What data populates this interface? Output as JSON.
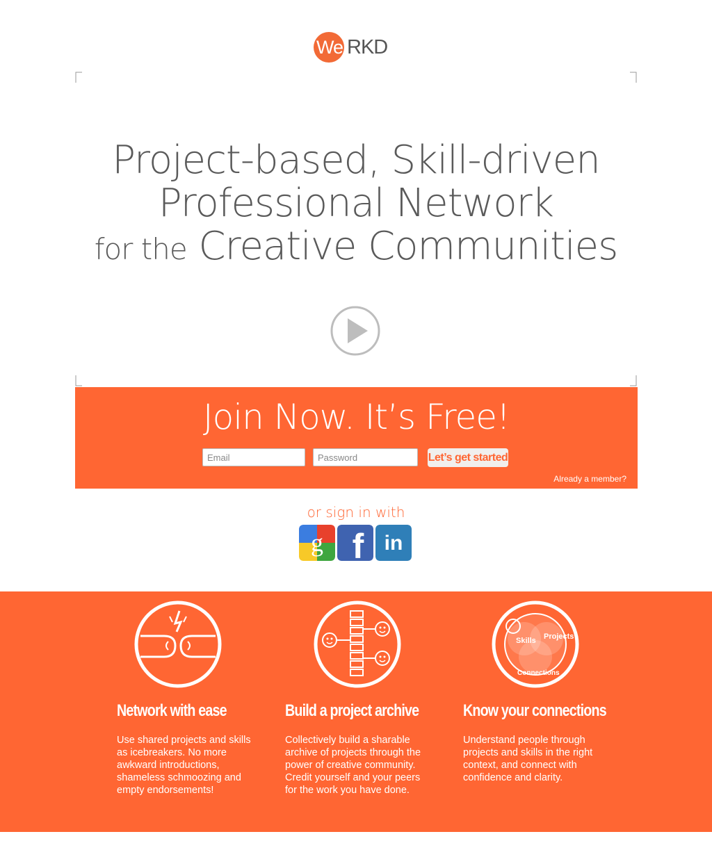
{
  "logo": {
    "we": "We",
    "rkd": "RKD"
  },
  "hero": {
    "line1": "Project-based, Skill-driven",
    "line2": "Professional Network",
    "line3_prefix": "for the",
    "line3_main": "Creative Communities"
  },
  "join": {
    "title": "Join Now. It’s Free!",
    "email_placeholder": "Email",
    "password_placeholder": "Password",
    "cta_label": "Let’s get started",
    "already_member": "Already a member?"
  },
  "social": {
    "label": "or sign in with",
    "providers": [
      "google-icon",
      "facebook-icon",
      "linkedin-icon"
    ]
  },
  "features": [
    {
      "icon": "fist-bump-icon",
      "title": "Network with ease",
      "desc": "Use shared projects and skills as icebreakers. No more awkward introductions, shameless schmoozing and empty endorsements!"
    },
    {
      "icon": "project-archive-icon",
      "title": "Build a project archive",
      "desc": "Collectively build a sharable archive of projects through the power of creative community. Credit yourself and your peers for the work you have done."
    },
    {
      "icon": "venn-connections-icon",
      "title": "Know your connections",
      "desc": "Understand people through projects and skills in the right context, and connect with confidence and clarity.",
      "venn_labels": {
        "skills": "Skills",
        "projects": "Projects",
        "connections": "Connections"
      }
    }
  ],
  "colors": {
    "accent": "#ff6633",
    "logo_orange": "#f26a36",
    "text_gray": "#5a5a5a"
  }
}
